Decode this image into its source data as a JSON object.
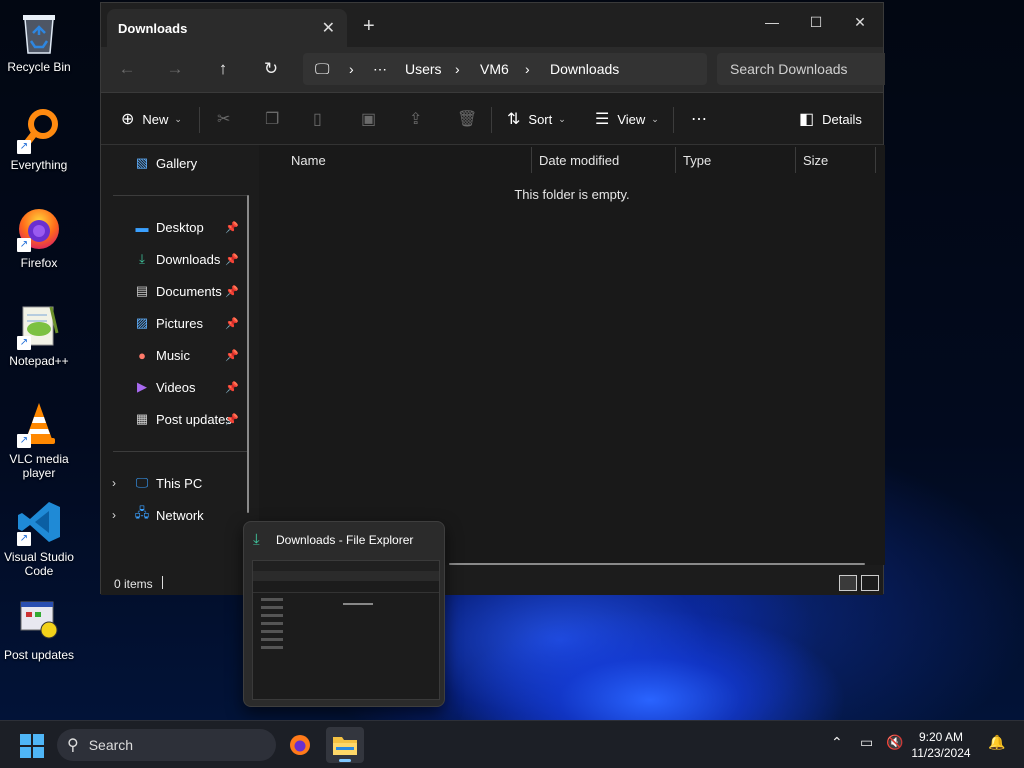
{
  "desktop": {
    "icons": [
      {
        "label": "Recycle Bin",
        "icon": "recycle-bin-icon"
      },
      {
        "label": "Everything",
        "icon": "everything-search-icon"
      },
      {
        "label": "Firefox",
        "icon": "firefox-icon"
      },
      {
        "label": "Notepad++",
        "icon": "notepad-plus-plus-icon"
      },
      {
        "label": "VLC media player",
        "icon": "vlc-cone-icon"
      },
      {
        "label": "Visual Studio Code",
        "icon": "vscode-icon"
      },
      {
        "label": "Post updates",
        "icon": "post-updates-icon"
      }
    ],
    "shortcut_glyph": "↗"
  },
  "window": {
    "tab_title": "Downloads",
    "tab_close": "✕",
    "new_tab": "+",
    "controls": {
      "minimize": "—",
      "maximize": "☐",
      "close": "✕"
    },
    "nav": {
      "back": "←",
      "forward": "→",
      "up": "↑",
      "refresh": "↻"
    },
    "address": {
      "computer_glyph": "🖵",
      "separator": "›",
      "ellipsis": "⋯",
      "segments": [
        "Users",
        "VM6",
        "Downloads"
      ]
    },
    "search_placeholder": "Search Downloads",
    "commands": {
      "new": "New",
      "sort": "Sort",
      "view": "View",
      "more": "⋯",
      "details": "Details",
      "chevron": "⌄"
    },
    "nav_pane": {
      "gallery": "Gallery",
      "quick_access": [
        {
          "label": "Desktop",
          "icon": "desktop-icon"
        },
        {
          "label": "Downloads",
          "icon": "downloads-icon"
        },
        {
          "label": "Documents",
          "icon": "documents-icon"
        },
        {
          "label": "Pictures",
          "icon": "pictures-icon"
        },
        {
          "label": "Music",
          "icon": "music-icon"
        },
        {
          "label": "Videos",
          "icon": "videos-icon"
        },
        {
          "label": "Post updates",
          "icon": "folder-icon"
        }
      ],
      "this_pc": "This PC",
      "network": "Network",
      "expand_glyph": "›"
    },
    "columns": [
      "Name",
      "Date modified",
      "Type",
      "Size"
    ],
    "empty_message": "This folder is empty.",
    "status": "0 items"
  },
  "preview": {
    "title": "Downloads - File Explorer"
  },
  "taskbar": {
    "search_label": "Search",
    "time": "9:20 AM",
    "date": "11/23/2024",
    "colors": {
      "start": "#4fb6f7",
      "indicator": "#7fc7ff"
    }
  }
}
